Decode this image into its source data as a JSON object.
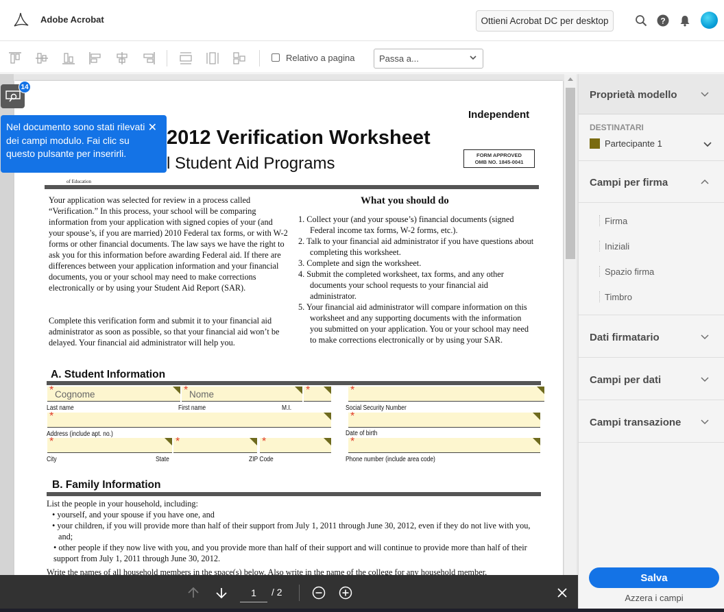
{
  "app": {
    "name": "Adobe Acrobat",
    "get_desktop_label": "Ottieni Acrobat DC per desktop"
  },
  "toolbar": {
    "relative_label": "Relativo a pagina",
    "goto_value": "Passa a..."
  },
  "field_detect": {
    "count": "14",
    "message": "Nel documento sono stati rilevati dei campi modulo. Fai clic su questo pulsante per inserirli."
  },
  "document": {
    "independent": "Independent",
    "title": "2012 Verification Worksheet",
    "subtitle": "l Student Aid Programs",
    "omb_line1": "FORM APPROVED",
    "omb_line2": "OMB NO. 1845-0041",
    "dept": "of Education",
    "intro_p1": "Your application was selected for review in a process called “Verification.”  In this process, your school will be comparing information from your application with signed copies of your (and your spouse’s, if you are married) 2010 Federal tax forms, or with W-2 forms or other financial documents.  The law says we have the right to ask you for this information before awarding Federal aid.  If there are differences between your application information and your financial documents, you or your school may need to make corrections electronically or by using your Student Aid Report (SAR).",
    "intro_p2": "Complete this verification form and submit it to your financial aid administrator as soon as possible, so that your financial aid won’t be delayed.  Your financial aid administrator will help you.",
    "what_title": "What you should do",
    "steps": [
      "1.  Collect your (and your spouse’s) financial documents (signed Federal income tax forms, W-2 forms, etc.).",
      "2.  Talk to your financial aid administrator if you have questions about completing this worksheet.",
      "3.  Complete and sign the worksheet.",
      "4.  Submit the completed worksheet, tax forms, and any other documents your school requests to your financial aid administrator.",
      "5.  Your financial aid administrator will compare information on this worksheet and any supporting documents with the information you submitted on your application.  You or your school may need to make corrections electronically or by using your SAR."
    ],
    "section_a": "A.  Student Information",
    "ph_lastname": "Cognome",
    "ph_firstname": "Nome",
    "star": "*",
    "lbl_last": "Last name",
    "lbl_first": "First name",
    "lbl_mi": "M.I.",
    "lbl_ssn": "Social Security Number",
    "lbl_address": "Address (include apt. no.)",
    "lbl_dob": "Date of birth",
    "lbl_city": "City",
    "lbl_state": "State",
    "lbl_zip": "ZIP Code",
    "lbl_phone": "Phone number (include area code)",
    "section_b": "B.  Family Information",
    "fam_intro": "List the people in your household, including:",
    "fam_b1": "• yourself, and your spouse if you have one, and",
    "fam_b2": "• your children, if you will provide more than half of their support from July 1, 2011 through June 30, 2012, even if they do not live with you, and;",
    "fam_b3": "• other people if they now live with you, and you provide more than half of their support and will continue to provide more than half of their support from July 1, 2011 through June 30, 2012.",
    "fam_last": "Write the names of all household members in the space(s) below.  Also write in the name of the college for any household member,"
  },
  "pagenav": {
    "current": "1",
    "total": "/ 2"
  },
  "panel": {
    "template_props": "Proprietà modello",
    "recipients_label": "DESTINATARI",
    "participant": "Partecipante 1",
    "signature_fields": "Campi per firma",
    "sig_items": [
      "Firma",
      "Iniziali",
      "Spazio firma",
      "Timbro"
    ],
    "signer_data": "Dati firmatario",
    "data_fields": "Campi per dati",
    "transaction_fields": "Campi transazione",
    "save": "Salva",
    "reset": "Azzera i campi"
  },
  "colors": {
    "accent": "#1473e6",
    "participant": "#7a6b10",
    "field_fill": "#fdf6cf"
  }
}
